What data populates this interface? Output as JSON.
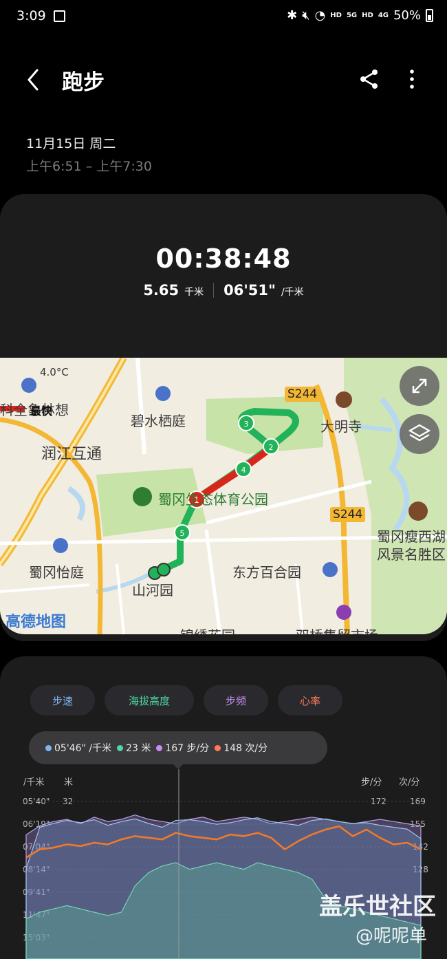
{
  "status_bar": {
    "time": "3:09",
    "network_1": "HD",
    "net_1_gen": "5G",
    "network_2": "HD",
    "net_2_gen": "4G",
    "battery": "50%"
  },
  "header": {
    "title": "跑步"
  },
  "session": {
    "date": "11月15日 周二",
    "time_range": "上午6:51 – 上午7:30"
  },
  "summary": {
    "duration": "00:38:48",
    "distance_value": "5.65",
    "distance_unit": "千米",
    "pace_value": "06'51\"",
    "pace_unit": "/千米"
  },
  "map": {
    "temperature": "4.0°C",
    "labels": {
      "place_1": "碧水栖庭",
      "place_2": "润江互通",
      "place_3": "科全象林想",
      "place_4": "大明寺",
      "place_5": "蜀冈生态体育公园",
      "place_6": "蜀冈怡庭",
      "place_7": "山河园",
      "place_8": "东方百合园",
      "place_9": "蜀冈瘦西湖",
      "place_10": "风景名胜区",
      "place_11": "锦绣花园",
      "place_12": "双桥集贸市场",
      "place_13": "最快"
    },
    "road_1": "S244",
    "road_2": "S244",
    "attribution": "高德地图",
    "km_markers": [
      "1",
      "2",
      "3",
      "4",
      "5"
    ],
    "colors": {
      "route_green": "#22b35a",
      "route_red": "#d9251c",
      "park": "#c7e3a8",
      "water": "#b8d7f0",
      "road": "#f3b734"
    }
  },
  "chart": {
    "tabs": [
      {
        "label": "步速",
        "color": "#7fb4ef"
      },
      {
        "label": "海拔高度",
        "color": "#4fd6a3"
      },
      {
        "label": "步频",
        "color": "#c88cf2"
      },
      {
        "label": "心率",
        "color": "#ff7a5a"
      }
    ],
    "tooltip": {
      "pace": "05'46\" /千米",
      "altitude": "23 米",
      "cadence": "167 步/分",
      "heart_rate": "148 次/分"
    },
    "left_units": [
      "/千米",
      "米"
    ],
    "right_units": [
      "步/分",
      "次/分"
    ],
    "pace_ticks": [
      "05'40\"",
      "06'19\"",
      "07'04\"",
      "08'14\"",
      "09'41\"",
      "11'47\"",
      "15'03\""
    ],
    "altitude_tick": "32",
    "cadence_tick": "172",
    "hr_ticks": [
      "169",
      "155",
      "142",
      "128"
    ]
  },
  "chart_data": {
    "type": "area",
    "series": [
      {
        "name": "步频",
        "values": [
          160,
          164,
          166,
          167,
          165,
          168,
          166,
          167,
          169,
          167,
          166,
          165,
          167,
          168,
          166,
          167,
          168,
          167,
          165,
          166,
          167,
          168,
          167,
          166,
          165,
          166,
          167,
          166,
          165,
          164
        ]
      },
      {
        "name": "步速",
        "values": [
          500,
          390,
          380,
          372,
          378,
          370,
          385,
          375,
          368,
          380,
          390,
          372,
          370,
          375,
          382,
          378,
          370,
          365,
          375,
          380,
          385,
          372,
          368,
          375,
          380,
          378,
          385,
          390,
          395,
          420
        ]
      },
      {
        "name": "海拔高度",
        "values": [
          8,
          10,
          11,
          12,
          11,
          10,
          9,
          10,
          18,
          22,
          24,
          25,
          23,
          24,
          25,
          24,
          23,
          25,
          24,
          23,
          22,
          20,
          14,
          12,
          11,
          10,
          9,
          8,
          7,
          6
        ]
      },
      {
        "name": "心率",
        "values": [
          135,
          140,
          141,
          143,
          142,
          144,
          143,
          146,
          148,
          147,
          146,
          150,
          148,
          147,
          146,
          149,
          148,
          150,
          147,
          140,
          145,
          149,
          152,
          154,
          148,
          152,
          147,
          143,
          144,
          140
        ]
      }
    ],
    "tooltip_values": {
      "pace": "05'46\"",
      "altitude": 23,
      "cadence": 167,
      "heart_rate": 148
    }
  }
}
